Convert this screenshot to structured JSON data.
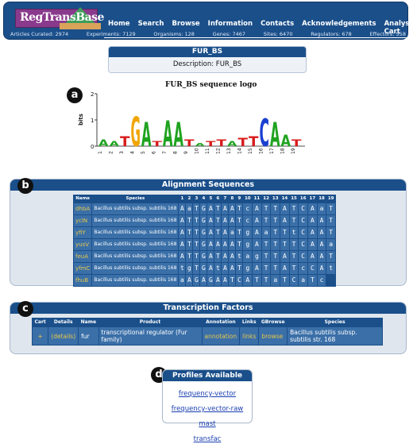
{
  "header": {
    "logo_text": "RegTransBase",
    "nav": [
      "Home",
      "Search",
      "Browse",
      "Information",
      "Contacts",
      "Acknowledgements",
      "Analysis Cart"
    ],
    "stats": [
      "Articles Curated: 2974",
      "Experiments: 7129",
      "Organisms: 128",
      "Genes: 7467",
      "Sites: 6470",
      "Regulators: 678",
      "Effectors: 558"
    ]
  },
  "description_box": {
    "title": "FUR_BS",
    "description": "Description: FUR_BS"
  },
  "markers": {
    "a": "a",
    "b": "b",
    "c": "c",
    "d": "d"
  },
  "sequence_logo": {
    "title": "FUR_BS sequence logo",
    "ylabel": "bits",
    "yticks": [
      "0",
      "1",
      "2"
    ],
    "positions": [
      "1",
      "2",
      "3",
      "4",
      "5",
      "6",
      "7",
      "8",
      "9",
      "10",
      "11",
      "12",
      "13",
      "14",
      "15",
      "16",
      "17",
      "18",
      "19"
    ],
    "letters": [
      "A",
      "A",
      "T",
      "G",
      "A",
      "T",
      "A",
      "A",
      "T",
      "A",
      "T",
      "T",
      "A",
      "T",
      "T",
      "C",
      "A",
      "A",
      "T"
    ],
    "colors": {
      "A": "#1fa31f",
      "T": "#d81b1b",
      "G": "#f0a500",
      "C": "#1a3fd1"
    }
  },
  "alignment": {
    "title": "Alignment Sequences",
    "headers": [
      "Name",
      "Species",
      "1",
      "2",
      "3",
      "4",
      "5",
      "6",
      "7",
      "8",
      "9",
      "10",
      "11",
      "12",
      "13",
      "14",
      "15",
      "16",
      "17",
      "18",
      "19"
    ],
    "rows": [
      {
        "name": "dhbA",
        "species": "Bacillus subtilis subsp. subtilis 168",
        "seq": [
          "A",
          "a",
          "T",
          "G",
          "A",
          "T",
          "A",
          "A",
          "T",
          "c",
          "A",
          "T",
          "T",
          "A",
          "T",
          "C",
          "A",
          "a",
          "T"
        ]
      },
      {
        "name": "yclN",
        "species": "Bacillus subtilis subsp. subtilis 168",
        "seq": [
          "A",
          "T",
          "T",
          "G",
          "A",
          "T",
          "A",
          "A",
          "T",
          "c",
          "A",
          "T",
          "T",
          "A",
          "T",
          "C",
          "A",
          "A",
          "T"
        ]
      },
      {
        "name": "yfiY",
        "species": "Bacillus subtilis subsp. subtilis 168",
        "seq": [
          "A",
          "T",
          "T",
          "G",
          "A",
          "T",
          "A",
          "a",
          "T",
          "g",
          "A",
          "a",
          "T",
          "T",
          "t",
          "C",
          "A",
          "A",
          "T"
        ]
      },
      {
        "name": "yusV",
        "species": "Bacillus subtilis subsp. subtilis 168",
        "seq": [
          "A",
          "T",
          "T",
          "G",
          "A",
          "A",
          "A",
          "A",
          "T",
          "g",
          "A",
          "T",
          "T",
          "T",
          "T",
          "C",
          "A",
          "A",
          "a"
        ]
      },
      {
        "name": "feuA",
        "species": "Bacillus subtilis subsp. subtilis 168",
        "seq": [
          "A",
          "T",
          "T",
          "G",
          "A",
          "T",
          "A",
          "A",
          "t",
          "a",
          "g",
          "T",
          "T",
          "A",
          "T",
          "C",
          "A",
          "A",
          "T"
        ]
      },
      {
        "name": "yfmC",
        "species": "Bacillus subtilis subsp. subtilis 168",
        "seq": [
          "t",
          "g",
          "T",
          "G",
          "A",
          "t",
          "A",
          "A",
          "T",
          "g",
          "A",
          "T",
          "T",
          "A",
          "T",
          "c",
          "C",
          "A",
          "t",
          "t"
        ]
      },
      {
        "name": "fhuB",
        "species": "Bacillus subtilis subsp. subtilis 168",
        "seq": [
          "a",
          "A",
          "G",
          "A",
          "G",
          "A",
          "A",
          "T",
          "C",
          "A",
          "T",
          "T",
          "a",
          "T",
          "C",
          "a",
          "T",
          "c"
        ]
      }
    ]
  },
  "transcription_factors": {
    "title": "Transcription Factors",
    "headers": [
      "Cart",
      "Details",
      "Name",
      "Product",
      "Annotation",
      "Links",
      "GBrowse",
      "Species"
    ],
    "row": {
      "cart": "+",
      "details": "(details)",
      "name": "fur",
      "product": "transcriptional regulator (Fur family)",
      "annotation": "annotation",
      "links": "links",
      "gbrowse": "browse",
      "species": "Bacillus subtilis subsp. subtilis str. 168"
    }
  },
  "profiles": {
    "title": "Profiles Available",
    "links": [
      "frequency-vector",
      "frequency-vector-raw",
      "mast",
      "transfac"
    ]
  }
}
